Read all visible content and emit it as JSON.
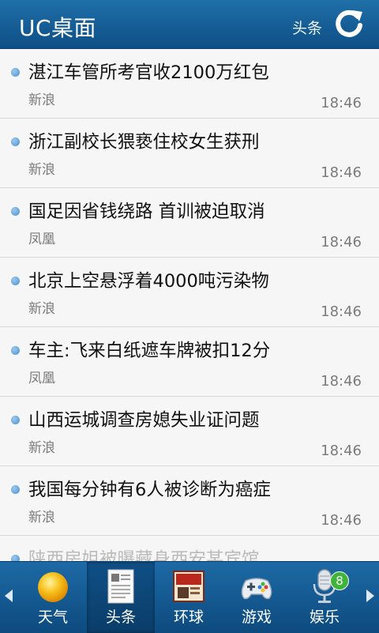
{
  "header": {
    "title": "UC桌面",
    "section": "头条"
  },
  "news": [
    {
      "headline": "湛江车管所考官收2100万红包",
      "source": "新浪",
      "time": "18:46"
    },
    {
      "headline": "浙江副校长猥亵住校女生获刑",
      "source": "新浪",
      "time": "18:46"
    },
    {
      "headline": "国足因省钱绕路 首训被迫取消",
      "source": "凤凰",
      "time": "18:46"
    },
    {
      "headline": "北京上空悬浮着4000吨污染物",
      "source": "新浪",
      "time": "18:46"
    },
    {
      "headline": "车主:飞来白纸遮车牌被扣12分",
      "source": "凤凰",
      "time": "18:46"
    },
    {
      "headline": "山西运城调查房媳失业证问题",
      "source": "新浪",
      "time": "18:46"
    },
    {
      "headline": "我国每分钟有6人被诊断为癌症",
      "source": "新浪",
      "time": "18:46"
    },
    {
      "headline": "陕西房姐被曝藏身西安某宾馆",
      "source": "",
      "time": ""
    }
  ],
  "nav": {
    "items": [
      {
        "label": "天气",
        "icon": "sun-icon"
      },
      {
        "label": "头条",
        "icon": "newspaper-icon"
      },
      {
        "label": "环球",
        "icon": "magazine-icon"
      },
      {
        "label": "游戏",
        "icon": "gamepad-icon"
      },
      {
        "label": "娱乐",
        "icon": "microphone-icon",
        "badge": "8"
      }
    ]
  },
  "colors": {
    "header_bg": "#1f6fa9",
    "nav_bg": "#0d4a7e",
    "bullet": "#4a8fd0",
    "badge": "#3fb33a"
  }
}
